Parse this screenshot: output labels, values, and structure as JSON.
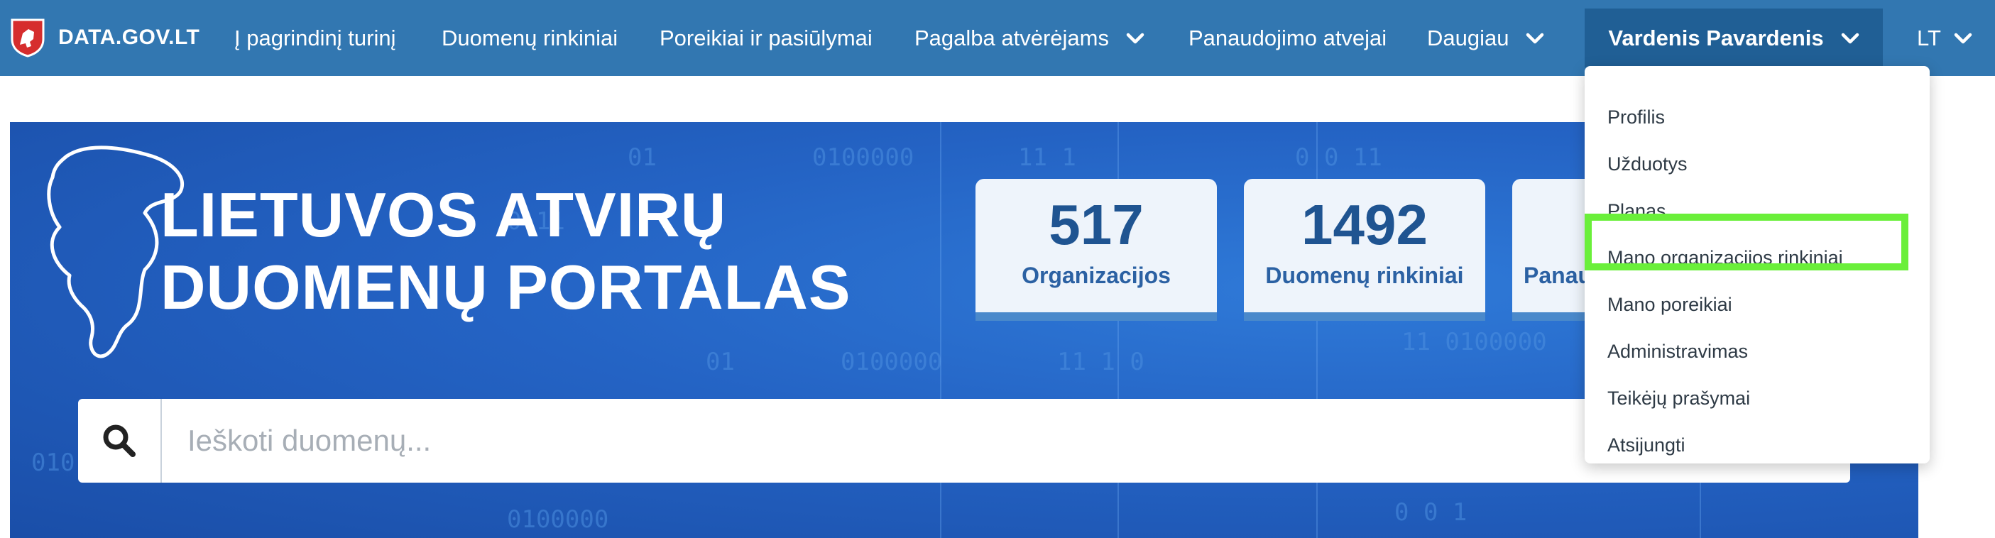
{
  "nav": {
    "brand": "DATA.GOV.LT",
    "items": [
      "Į pagrindinį turinį",
      "Duomenų rinkiniai",
      "Poreikiai ir pasiūlymai",
      "Pagalba atvėrėjams",
      "Panaudojimo atvejai",
      "Daugiau"
    ],
    "user": "Vardenis Pavardenis",
    "language": "LT"
  },
  "hero": {
    "title_line1": "LIETUVOS ATVIRŲ",
    "title_line2": "DUOMENŲ PORTALAS",
    "stats": [
      {
        "value": "517",
        "label": "Organizacijos"
      },
      {
        "value": "1492",
        "label": "Duomenų rinkiniai"
      },
      {
        "value": "",
        "label": "Panau"
      }
    ],
    "search_placeholder": "Ieškoti duomenų..."
  },
  "user_menu": {
    "items": [
      "Profilis",
      "Užduotys",
      "Planas",
      "Mano organizacijos rinkiniai",
      "Mano poreikiai",
      "Administravimas",
      "Teikėjų prašymai",
      "Atsijungti"
    ],
    "highlighted_item": "Mano organizacijos rinkiniai",
    "highlight_color": "#6aef3a"
  },
  "colors": {
    "navbar": "#3277b1",
    "user_menu_bg": "#205f95",
    "hero_blue": "#2463c4"
  }
}
